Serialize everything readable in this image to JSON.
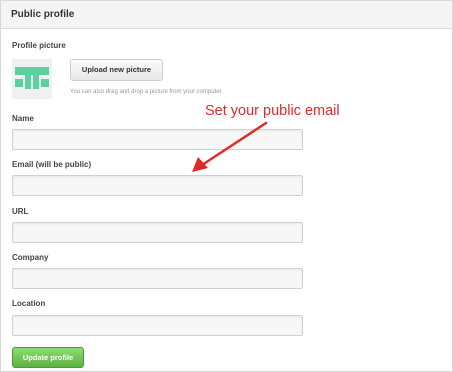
{
  "panel": {
    "title": "Public profile"
  },
  "profile_picture": {
    "label": "Profile picture",
    "upload_button_label": "Upload new picture",
    "hint": "You can also drag and drop a picture from your computer.",
    "avatar_color": "#5ecfa0"
  },
  "annotation": {
    "text": "Set your public email",
    "color": "#e02a2a"
  },
  "fields": {
    "name": {
      "label": "Name",
      "value": ""
    },
    "email": {
      "label": "Email (will be public)",
      "value": ""
    },
    "url": {
      "label": "URL",
      "value": ""
    },
    "company": {
      "label": "Company",
      "value": ""
    },
    "location": {
      "label": "Location",
      "value": ""
    }
  },
  "update_button_label": "Update profile",
  "colors": {
    "header_bg": "#f5f5f5",
    "field_bg": "#f7f7f7",
    "update_button": "#6cc04a"
  }
}
